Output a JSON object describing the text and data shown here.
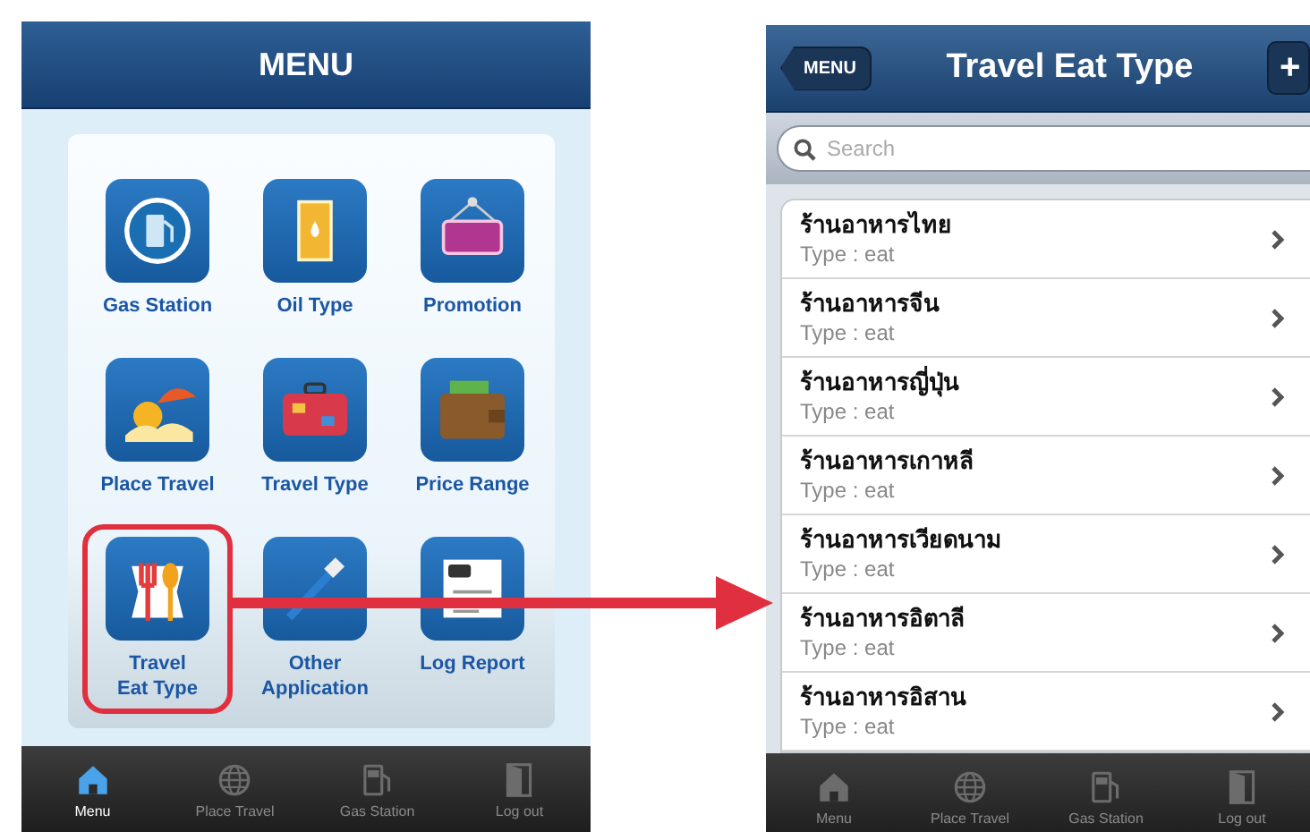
{
  "menu_screen": {
    "title": "MENU",
    "items": [
      {
        "label": "Gas Station",
        "kind": "gas",
        "highlighted": false
      },
      {
        "label": "Oil Type",
        "kind": "oil",
        "highlighted": false
      },
      {
        "label": "Promotion",
        "kind": "promo",
        "highlighted": false
      },
      {
        "label": "Place Travel",
        "kind": "place",
        "highlighted": false
      },
      {
        "label": "Travel Type",
        "kind": "suitcase",
        "highlighted": false
      },
      {
        "label": "Price Range",
        "kind": "wallet",
        "highlighted": false
      },
      {
        "label": "Travel\nEat Type",
        "kind": "eat",
        "highlighted": true
      },
      {
        "label": "Other\nApplication",
        "kind": "other",
        "highlighted": false
      },
      {
        "label": "Log Report",
        "kind": "log",
        "highlighted": false
      }
    ],
    "tab_bar": [
      {
        "label": "Menu",
        "kind": "home",
        "selected": true
      },
      {
        "label": "Place Travel",
        "kind": "globe",
        "selected": false
      },
      {
        "label": "Gas Station",
        "kind": "pump",
        "selected": false
      },
      {
        "label": "Log out",
        "kind": "door",
        "selected": false
      }
    ]
  },
  "list_screen": {
    "back_button": "MENU",
    "title": "Travel Eat Type",
    "add_button": "+",
    "search": {
      "placeholder": "Search"
    },
    "rows": [
      {
        "title": "ร้านอาหารไทย",
        "subtitle": "Type : eat"
      },
      {
        "title": "ร้านอาหารจีน",
        "subtitle": "Type : eat"
      },
      {
        "title": "ร้านอาหารญี่ปุ่น",
        "subtitle": "Type : eat"
      },
      {
        "title": "ร้านอาหารเกาหลี",
        "subtitle": "Type : eat"
      },
      {
        "title": "ร้านอาหารเวียดนาม",
        "subtitle": "Type : eat"
      },
      {
        "title": "ร้านอาหารอิตาลี",
        "subtitle": "Type : eat"
      },
      {
        "title": "ร้านอาหารอิสาน",
        "subtitle": "Type : eat"
      }
    ],
    "tab_bar": [
      {
        "label": "Menu",
        "kind": "home",
        "selected": false
      },
      {
        "label": "Place Travel",
        "kind": "globe",
        "selected": false
      },
      {
        "label": "Gas Station",
        "kind": "pump",
        "selected": false
      },
      {
        "label": "Log out",
        "kind": "door",
        "selected": false
      }
    ]
  }
}
